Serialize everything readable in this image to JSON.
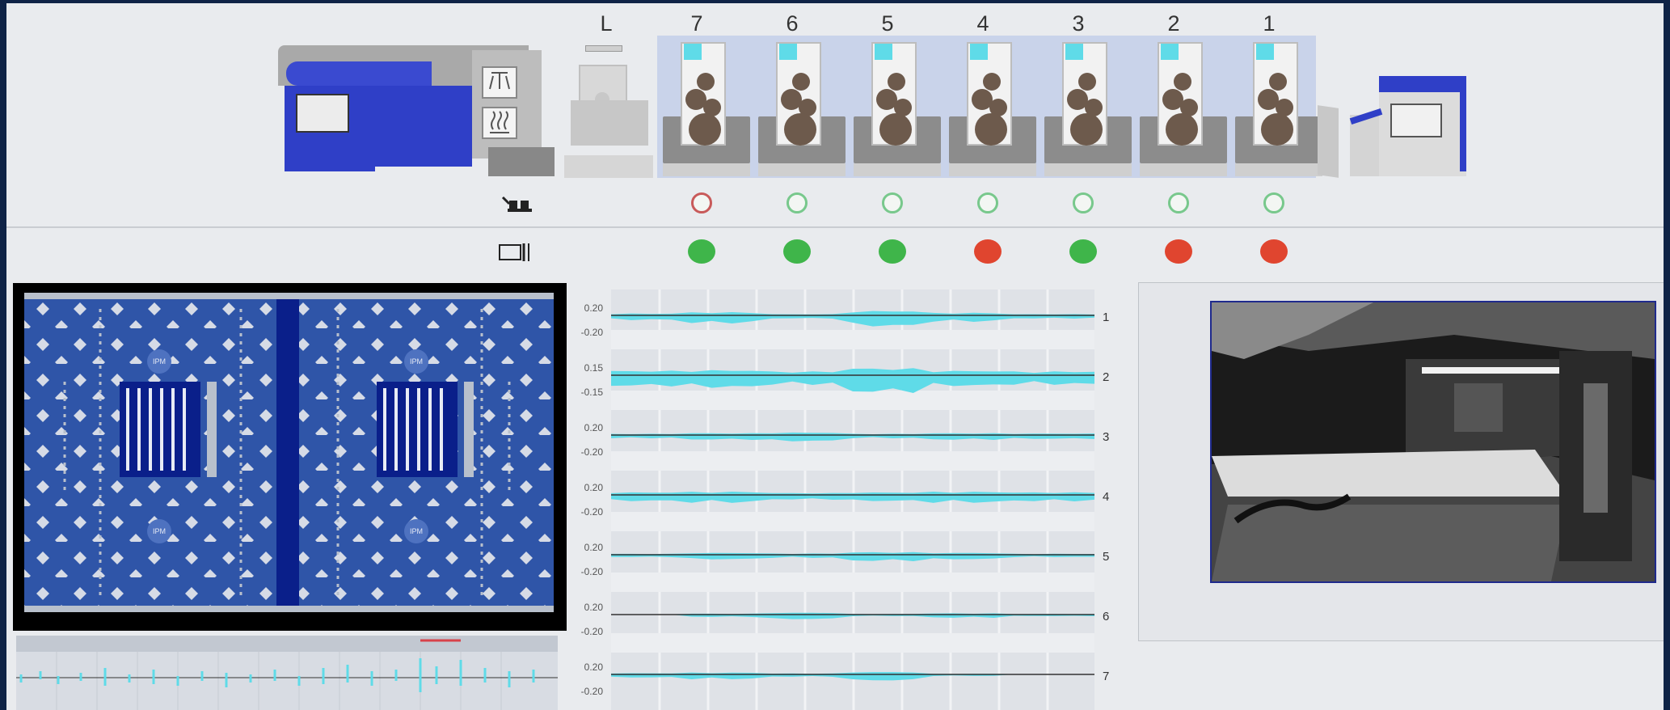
{
  "units": [
    {
      "id": "L",
      "status": "none"
    },
    {
      "id": "7",
      "register": "red",
      "status": "green"
    },
    {
      "id": "6",
      "register": "green",
      "status": "green"
    },
    {
      "id": "5",
      "register": "green",
      "status": "green"
    },
    {
      "id": "4",
      "register": "green",
      "status": "red"
    },
    {
      "id": "3",
      "register": "green",
      "status": "green"
    },
    {
      "id": "2",
      "register": "green",
      "status": "red"
    },
    {
      "id": "1",
      "register": "green",
      "status": "red"
    }
  ],
  "trend": {
    "rows": [
      {
        "id": "1",
        "upper": "0.20",
        "lower": "-0.20"
      },
      {
        "id": "2",
        "upper": "0.15",
        "lower": "-0.15"
      },
      {
        "id": "3",
        "upper": "0.20",
        "lower": "-0.20"
      },
      {
        "id": "4",
        "upper": "0.20",
        "lower": "-0.20"
      },
      {
        "id": "5",
        "upper": "0.20",
        "lower": "-0.20"
      },
      {
        "id": "6",
        "upper": "0.20",
        "lower": "-0.20"
      },
      {
        "id": "7",
        "upper": "0.20",
        "lower": "-0.20"
      }
    ]
  },
  "sheet_preview": {
    "logos": [
      "IPM",
      "IPM",
      "IPM",
      "IPM"
    ]
  },
  "icons": {
    "register_row": "register-marks-icon",
    "status_row": "sheet-edge-icon",
    "feeder_top": "air-blast-icon",
    "feeder_bottom": "dryer-heat-icon"
  },
  "colors": {
    "accent_cyan": "#5fdbe8",
    "status_green": "#3fb54a",
    "status_red": "#e0452f",
    "sheet_blue": "#2f55a8"
  }
}
